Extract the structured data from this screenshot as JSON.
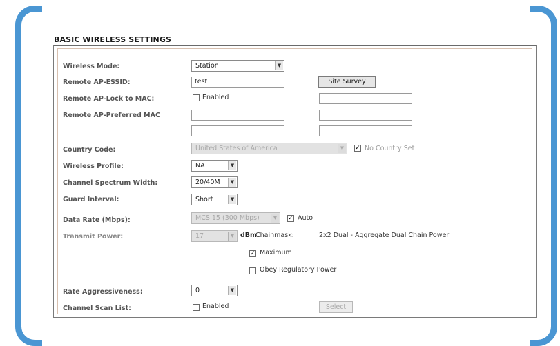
{
  "section_title": "BASIC WIRELESS SETTINGS",
  "wireless_mode": {
    "label": "Wireless Mode:",
    "value": "Station"
  },
  "remote_essid": {
    "label": "Remote AP-ESSID:",
    "value": "test",
    "site_survey": "Site Survey"
  },
  "lock_to_mac": {
    "label": "Remote AP-Lock to MAC:",
    "checkbox_label": "Enabled",
    "checked": false,
    "value": ""
  },
  "preferred_mac": {
    "label": "Remote AP-Preferred MAC",
    "values": [
      "",
      "",
      "",
      ""
    ]
  },
  "country_code": {
    "label": "Country Code:",
    "value": "United States of America",
    "no_country_label": "No Country Set",
    "no_country_checked": true
  },
  "wireless_profile": {
    "label": "Wireless Profile:",
    "value": "NA"
  },
  "channel_width": {
    "label": "Channel Spectrum Width:",
    "value": "20/40M"
  },
  "guard_interval": {
    "label": "Guard Interval:",
    "value": "Short"
  },
  "data_rate": {
    "label": "Data Rate (Mbps):",
    "value": "MCS 15 (300 Mbps)",
    "auto_label": "Auto",
    "auto_checked": true
  },
  "transmit_power": {
    "label": "Transmit Power:",
    "value": "17",
    "unit": "dBm",
    "chainmask_label": "Chainmask:",
    "chainmask_value": "2x2 Dual - Aggregate Dual Chain Power",
    "maximum_label": "Maximum",
    "maximum_checked": true,
    "obey_label": "Obey Regulatory Power",
    "obey_checked": false
  },
  "rate_aggressiveness": {
    "label": "Rate Aggressiveness:",
    "value": "0"
  },
  "channel_scan": {
    "label": "Channel Scan List:",
    "checkbox_label": "Enabled",
    "checked": false,
    "select_button": "Select"
  },
  "theme": {
    "bracket_color": "#4a96d3"
  }
}
